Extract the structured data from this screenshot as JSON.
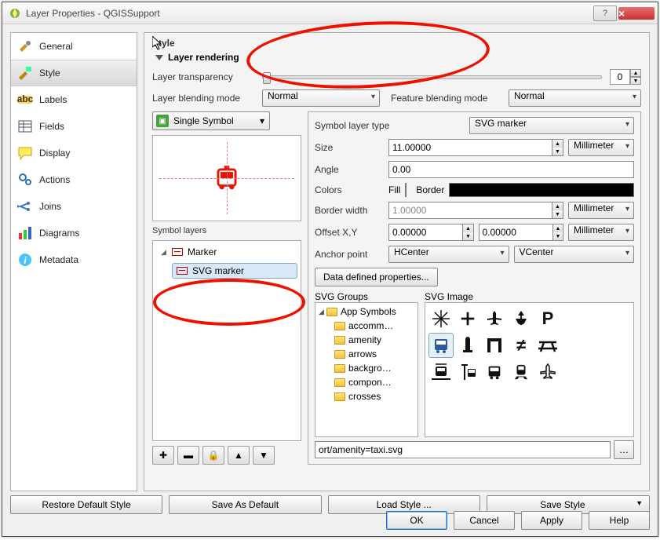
{
  "window": {
    "title": "Layer Properties - QGISSupport"
  },
  "sidebar": {
    "items": [
      {
        "label": "General"
      },
      {
        "label": "Style"
      },
      {
        "label": "Labels"
      },
      {
        "label": "Fields"
      },
      {
        "label": "Display"
      },
      {
        "label": "Actions"
      },
      {
        "label": "Joins"
      },
      {
        "label": "Diagrams"
      },
      {
        "label": "Metadata"
      }
    ],
    "selected_index": 1
  },
  "style": {
    "heading": "Style",
    "rendering": {
      "section": "Layer rendering",
      "transparency_label": "Layer transparency",
      "transparency_value": "0",
      "layer_blend_label": "Layer blending mode",
      "layer_blend_value": "Normal",
      "feature_blend_label": "Feature blending mode",
      "feature_blend_value": "Normal"
    },
    "symbol_type": "Single Symbol",
    "symbol_layers_label": "Symbol layers",
    "tree": {
      "root": "Marker",
      "child": "SVG marker"
    },
    "props": {
      "layer_type_label": "Symbol layer type",
      "layer_type_value": "SVG marker",
      "size_label": "Size",
      "size_value": "11.00000",
      "size_unit": "Millimeter",
      "angle_label": "Angle",
      "angle_value": "0.00",
      "colors_label": "Colors",
      "fill_label": "Fill",
      "fill_color": "#ff0000",
      "border_label": "Border",
      "border_color": "#000000",
      "border_width_label": "Border width",
      "border_width_value": "1.00000",
      "border_width_unit": "Millimeter",
      "offset_label": "Offset X,Y",
      "offset_x": "0.00000",
      "offset_y": "0.00000",
      "offset_unit": "Millimeter",
      "anchor_label": "Anchor point",
      "anchor_h": "HCenter",
      "anchor_v": "VCenter",
      "data_defined_btn": "Data defined properties...",
      "svg_groups_label": "SVG Groups",
      "svg_image_label": "SVG Image",
      "groups": {
        "root": "App Symbols",
        "children": [
          "accomm…",
          "amenity",
          "arrows",
          "backgro…",
          "compon…",
          "crosses"
        ]
      },
      "path_value": "ort/amenity=taxi.svg",
      "browse_btn": "…"
    }
  },
  "buttons": {
    "restore": "Restore Default Style",
    "save_default": "Save As Default",
    "load": "Load Style ...",
    "save": "Save Style",
    "ok": "OK",
    "cancel": "Cancel",
    "apply": "Apply",
    "help": "Help"
  },
  "glyphs": {
    "add": "✚",
    "remove": "▬",
    "lock": "🔒",
    "up": "▲",
    "down": "▼"
  }
}
